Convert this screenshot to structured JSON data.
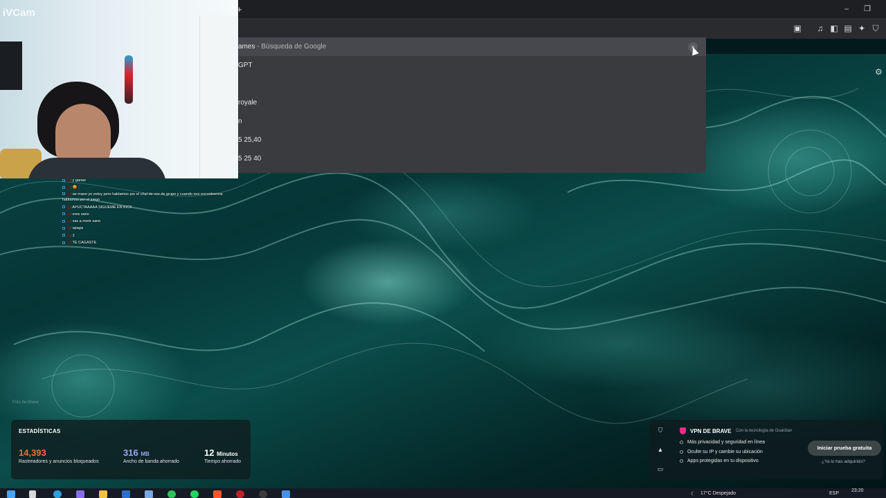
{
  "browser": {
    "new_tab_glyph": "+",
    "window_controls": {
      "minimize": "–",
      "restore": "❐"
    },
    "extension_icons": [
      "tab-search-icon",
      "music-icon",
      "sidebar-icon",
      "wallet-icon",
      "leo-ai-icon",
      "shield-icon"
    ]
  },
  "omnibox": {
    "suggestions": [
      {
        "main": "ames",
        "sub": " - Búsqueda de Google",
        "selected": true
      },
      {
        "main": "GPT",
        "sub": ""
      },
      {
        "main": "",
        "sub": ""
      },
      {
        "main": "royale",
        "sub": ""
      },
      {
        "main": "n",
        "sub": ""
      },
      {
        "main": "5 25,40",
        "sub": ""
      },
      {
        "main": "5 25 40",
        "sub": ""
      }
    ],
    "remove_glyph": "×"
  },
  "webcam": {
    "label": "iVCam"
  },
  "chat": {
    "lines": [
      {
        "user": "           ",
        "text": ": y ganas",
        "multi": false
      },
      {
        "user": "           ",
        "text": ": 😡",
        "multi": false
      },
      {
        "user": "           ",
        "text": ": oe mano yo estoy pero hablamos por el chat de voz de grupo y cuando nos encontremos hablamos por el juego",
        "multi": true
      },
      {
        "user": "           ",
        "text": ": APUCTAAAAA SIGUEME EN KICK",
        "multi": false
      },
      {
        "user": "           ",
        "text": ": eres sano",
        "multi": false
      },
      {
        "user": "           ",
        "text": ": vas a morir sano",
        "multi": false
      },
      {
        "user": "           ",
        "text": ": apaga",
        "multi": false
      },
      {
        "user": "           ",
        "text": ": 2",
        "multi": false
      },
      {
        "user": "           ",
        "text": ": TE CAGASTE",
        "multi": false
      }
    ]
  },
  "wallpaper": {
    "credit": "Foto de Brave",
    "settings_icon": "gear-icon"
  },
  "stats": {
    "title": "ESTADÍSTICAS",
    "trackers": {
      "value": "14,393",
      "caption": "Rastreadores y anuncios bloqueados",
      "color": "#f26b45"
    },
    "bandwidth": {
      "value": "316",
      "unit": "MB",
      "caption": "Ancho de banda ahorrado",
      "color": "#9da6f5"
    },
    "time": {
      "value": "12",
      "unit": "Minutos",
      "caption": "Tiempo ahorrado",
      "color": "#ffffff"
    }
  },
  "vpn": {
    "title": "VPN DE BRAVE",
    "subtitle": "Con la tecnología de  Guardian",
    "features": [
      "Más privacidad y seguridad en línea",
      "Oculte su IP y cambie su ubicación",
      "Apps protegidas en tu dispositivo"
    ],
    "cta": "Iniciar prueba gratuita",
    "link": "¿Ya lo has adquirido?",
    "accent": "#e0308a"
  },
  "taskbar": {
    "weather": "17°C  Despejado",
    "language": "ESP",
    "time": "23:20",
    "apps": [
      "windows-start-icon",
      "task-view-icon",
      "edge-icon",
      "copilot-icon",
      "file-explorer-icon",
      "mail-icon",
      "store-icon",
      "whatsapp-icon",
      "spotify-icon",
      "brave-icon",
      "app-red-icon",
      "obs-icon",
      "ivcam-icon"
    ]
  }
}
